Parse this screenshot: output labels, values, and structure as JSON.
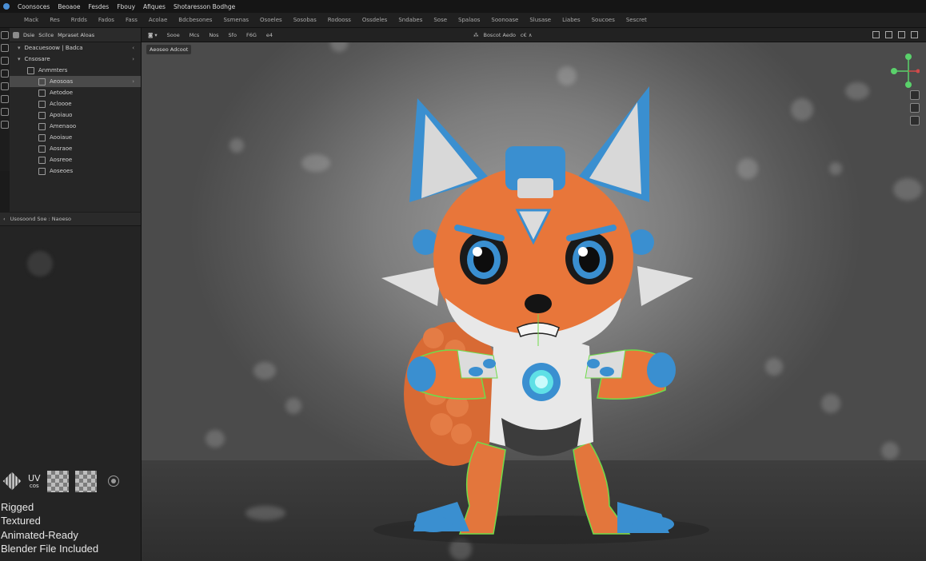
{
  "titlebar": {
    "items": [
      "Coonsoces",
      "Beoaoe",
      "Fesdes",
      "Fbouy",
      "Afiques",
      "Shotaresson Bodhge"
    ]
  },
  "menubar": {
    "items": [
      "Mack",
      "Res",
      "Rrdds",
      "Fados",
      "Fass",
      "Acolae",
      "Bdcbesones",
      "Ssmenas",
      "Osoeles",
      "Sosobas",
      "Rodooss",
      "Ossdeles",
      "Sndabes",
      "Sose",
      "Spalaos",
      "Soonoase",
      "Slusase",
      "Liabes",
      "Soucoes",
      "Sescret"
    ]
  },
  "outliner": {
    "header": {
      "chip1": "Dsie",
      "chip2": "Scilce",
      "label": "Mpraset Aloas"
    },
    "path": "Deacuesoow | Badca",
    "collection": "Cnsosare",
    "group": "Anmmters",
    "items": [
      "Aeosoas",
      "Aetodoe",
      "Acloooe",
      "Apoiauo",
      "Amenaoo",
      "Aooiaue",
      "Aosraoe",
      "Aosreoe",
      "Aoseoes"
    ]
  },
  "properties": {
    "header": "Usosoond Soe : Naoeso"
  },
  "badges": {
    "uv_big": "UV",
    "uv_small": "cos"
  },
  "features": [
    "Rigged",
    "Textured",
    "Animated-Ready",
    "Blender File Included"
  ],
  "viewport": {
    "header_items": [
      "Sooe",
      "Mcs",
      "Nos",
      "Sfo",
      "F6G",
      "e4"
    ],
    "header_mid": [
      "Boscot Aedo",
      "c€ ∧"
    ],
    "tag": "Aeoseo Adcoot"
  },
  "colors": {
    "fox_orange": "#e8763a",
    "fox_blue": "#3a8fd0",
    "rig_green": "#6fdc4a",
    "core_cyan": "#5fe0e6"
  }
}
